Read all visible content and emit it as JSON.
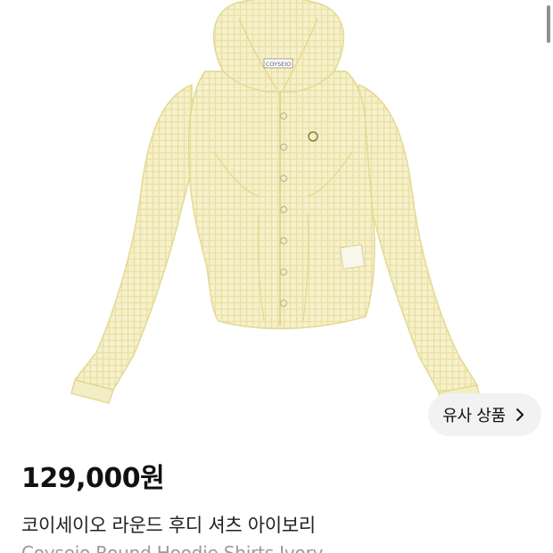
{
  "product": {
    "image_alt": "Ivory checked hoodie shirt",
    "label_tag": "COYSEIO",
    "similar_button_label": "유사 상품",
    "price": "129,000원",
    "title_korean": "코이세이오 라운드 후디 셔츠 아이보리",
    "title_english": "Coyseio Round Hoodie Shirts Ivory"
  },
  "icons": {
    "similar_chevron": "chevron-right-icon"
  },
  "colors": {
    "garment": "#f4efc4",
    "garment_line": "#e3d98f",
    "button_bg": "#f2f2f2",
    "price_text": "#111111",
    "subtitle_text": "#9a9a9a"
  }
}
